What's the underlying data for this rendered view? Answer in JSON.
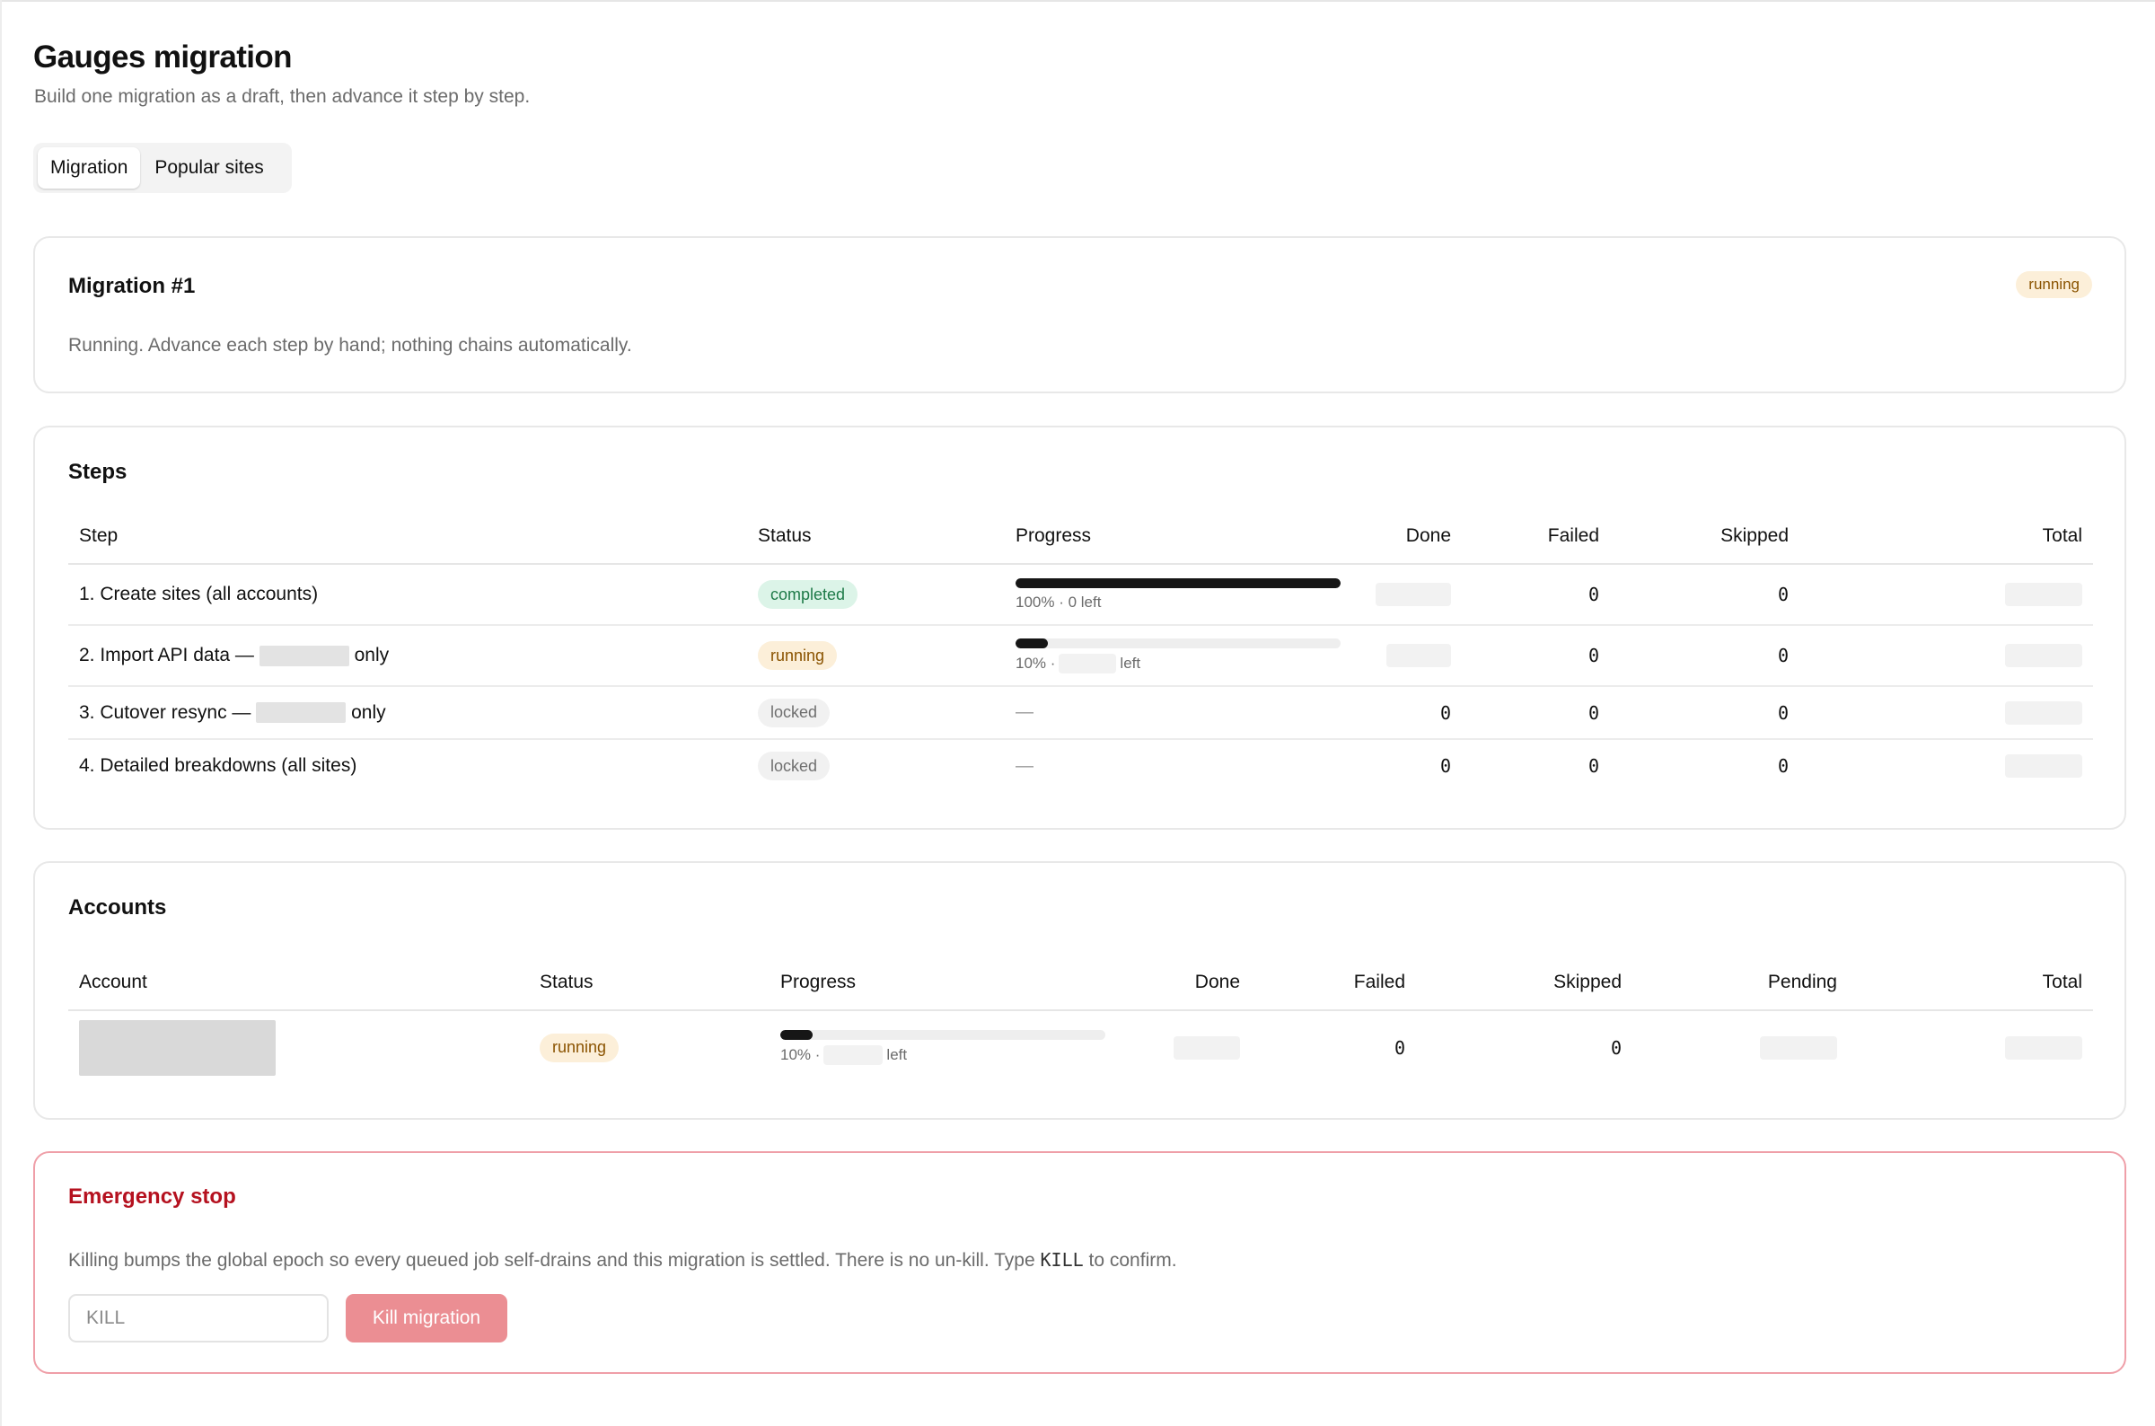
{
  "page": {
    "title": "Gauges migration",
    "subtitle": "Build one migration as a draft, then advance it step by step."
  },
  "tabs": [
    {
      "label": "Migration",
      "active": true
    },
    {
      "label": "Popular sites",
      "active": false
    }
  ],
  "migration": {
    "title": "Migration #1",
    "status": "running",
    "description": "Running. Advance each step by hand; nothing chains automatically."
  },
  "steps": {
    "title": "Steps",
    "columns": [
      "Step",
      "Status",
      "Progress",
      "Done",
      "Failed",
      "Skipped",
      "Total"
    ],
    "rows": [
      {
        "prefix": "1. Create sites (all accounts)",
        "suffix": "",
        "status": "completed",
        "progress_fraction": 1.0,
        "progress_text": "100% · 0 left",
        "progress_pct": "",
        "progress_after": "",
        "done": "",
        "failed": "0",
        "skipped": "0",
        "total": ""
      },
      {
        "prefix": "2. Import API data —",
        "suffix": "only",
        "status": "running",
        "progress_fraction": 0.1,
        "progress_text": "",
        "progress_pct": "10% ·",
        "progress_after": "left",
        "done": "",
        "failed": "0",
        "skipped": "0",
        "total": ""
      },
      {
        "prefix": "3. Cutover resync —",
        "suffix": "only",
        "status": "locked",
        "progress_fraction": null,
        "progress_text": "—",
        "progress_pct": "",
        "progress_after": "",
        "done": "0",
        "failed": "0",
        "skipped": "0",
        "total": ""
      },
      {
        "prefix": "4. Detailed breakdowns (all sites)",
        "suffix": "",
        "status": "locked",
        "progress_fraction": null,
        "progress_text": "—",
        "progress_pct": "",
        "progress_after": "",
        "done": "0",
        "failed": "0",
        "skipped": "0",
        "total": ""
      }
    ]
  },
  "accounts": {
    "title": "Accounts",
    "columns": [
      "Account",
      "Status",
      "Progress",
      "Done",
      "Failed",
      "Skipped",
      "Pending",
      "Total"
    ],
    "rows": [
      {
        "status": "running",
        "progress_fraction": 0.1,
        "progress_pct": "10% ·",
        "progress_after": "left",
        "failed": "0",
        "skipped": "0"
      }
    ]
  },
  "emergency": {
    "title": "Emergency stop",
    "desc_before": "Killing bumps the global epoch so every queued job self-drains and this migration is settled. There is no un-kill. Type",
    "desc_code": "KILL",
    "desc_after": "to confirm.",
    "input_placeholder": "KILL",
    "button_label": "Kill migration"
  },
  "colors": {
    "running_bg": "#fcefd9",
    "completed_bg": "#dcf4e8",
    "locked_bg": "#f1f1f1",
    "danger": "#b5111f",
    "danger_button": "#eb8e93",
    "progress_fill": "#161616"
  }
}
